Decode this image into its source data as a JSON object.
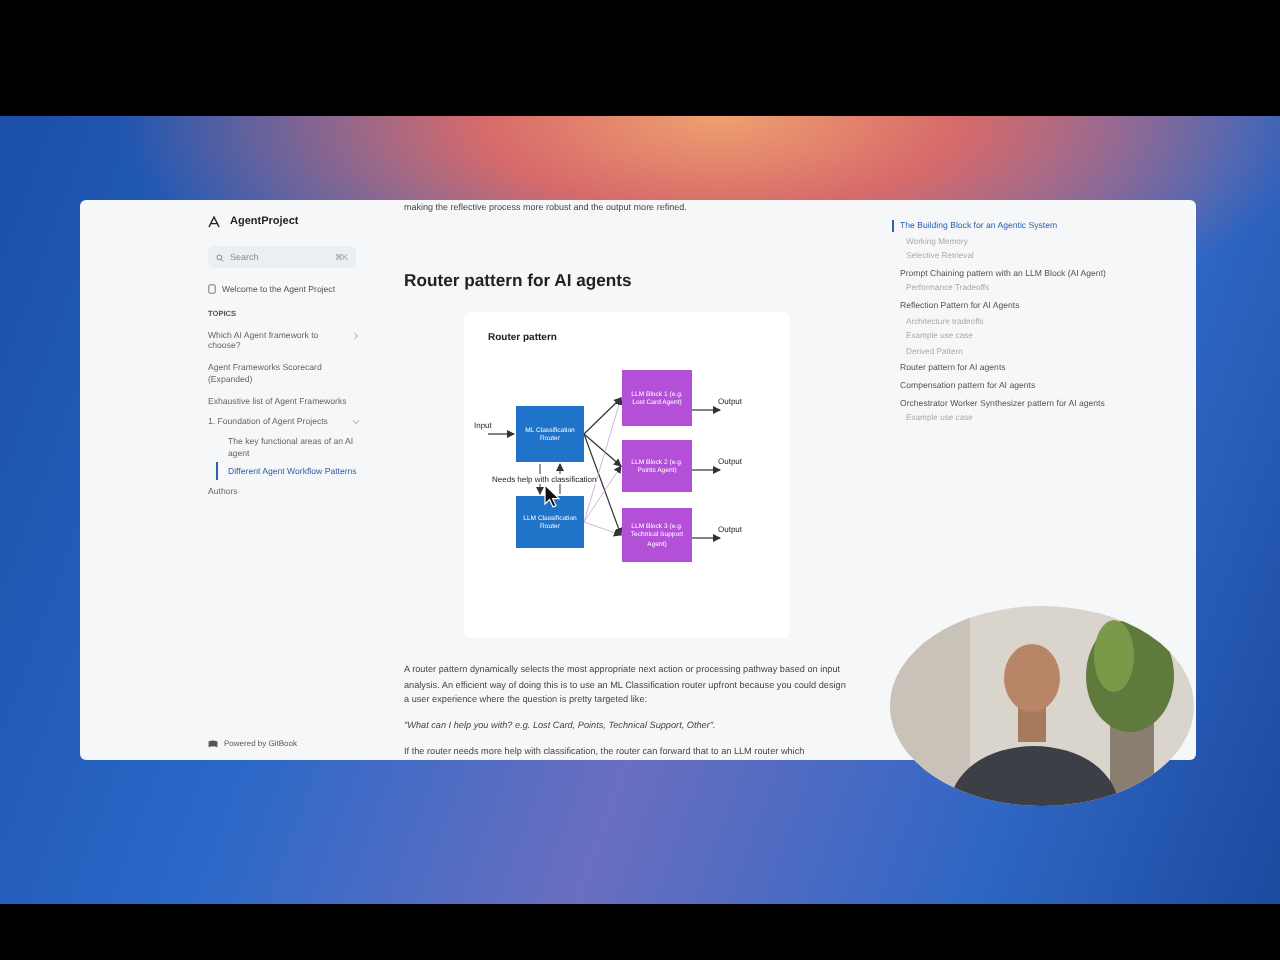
{
  "sidebar": {
    "brand": "AgentProject",
    "search": {
      "placeholder": "Search",
      "shortcut": "⌘K"
    },
    "welcome": "Welcome to the Agent Project",
    "section": "TOPICS",
    "items": [
      {
        "label": "Which AI Agent framework to choose?",
        "selected": false,
        "expanded": false
      },
      {
        "label": "Agent Frameworks Scorecard (Expanded)",
        "selected": false
      },
      {
        "label": "Exhaustive list of Agent Frameworks",
        "selected": false
      },
      {
        "label": "1. Foundation of Agent Projects",
        "selected": false,
        "expanded": true,
        "children": [
          {
            "label": "The key functional areas of an AI agent",
            "selected": false
          },
          {
            "label": "Different Agent Workflow Patterns",
            "selected": true
          }
        ]
      },
      {
        "label": "Authors",
        "selected": false
      }
    ],
    "footer": "Powered by GitBook"
  },
  "content": {
    "intro": "making the reflective process more robust and the output more refined.",
    "heading": "Router pattern for AI agents",
    "diagram": {
      "title": "Router pattern",
      "input": "Input",
      "note": "Needs help with classification",
      "nodes": [
        {
          "kind": "router",
          "label": "ML Classification Router"
        },
        {
          "kind": "router",
          "label": "LLM Classification Router"
        },
        {
          "kind": "block",
          "label": "LLM Block 1 (e.g. Lost Card Agent)"
        },
        {
          "kind": "block",
          "label": "LLM Block 2 (e.g. Points Agent)"
        },
        {
          "kind": "block",
          "label": "LLM Block 3 (e.g. Technical Support Agent)"
        }
      ],
      "outputs": [
        "Output",
        "Output",
        "Output"
      ]
    },
    "paragraph": "A router pattern dynamically selects the most appropriate next action or processing pathway based on input analysis.  An efficient way of doing this is to use an ML Classification router upfront because you could design a user experience where the question is pretty targeted like:",
    "quote": "\"What can I help you with? e.g.  Lost Card, Points, Technical Support, Other\".",
    "cut_line": "If the router needs more help with classification, the router can forward that to an LLM router which"
  },
  "toc": {
    "items": [
      {
        "label": "The Building Block for an Agentic System",
        "selected": true,
        "children": [
          {
            "label": "Working Memory",
            "selected": false
          },
          {
            "label": "Selective Retrieval",
            "selected": false
          }
        ]
      },
      {
        "label": "Prompt Chaining pattern with an LLM Block (AI Agent)",
        "selected": false,
        "children": [
          {
            "label": "Performance Tradeoffs",
            "selected": false
          }
        ]
      },
      {
        "label": "Reflection Pattern for AI Agents",
        "selected": false,
        "children": [
          {
            "label": "Architecture tradeoffs",
            "selected": false
          },
          {
            "label": "Example use case",
            "selected": false
          },
          {
            "label": "Derived Pattern",
            "selected": false
          }
        ]
      },
      {
        "label": "Router pattern for AI agents",
        "selected": false
      },
      {
        "label": "Compensation pattern for AI agents",
        "selected": false
      },
      {
        "label": "Orchestrator Worker Synthesizer pattern for AI agents",
        "selected": false,
        "children": [
          {
            "label": "Example use case",
            "selected": false
          }
        ]
      }
    ]
  }
}
